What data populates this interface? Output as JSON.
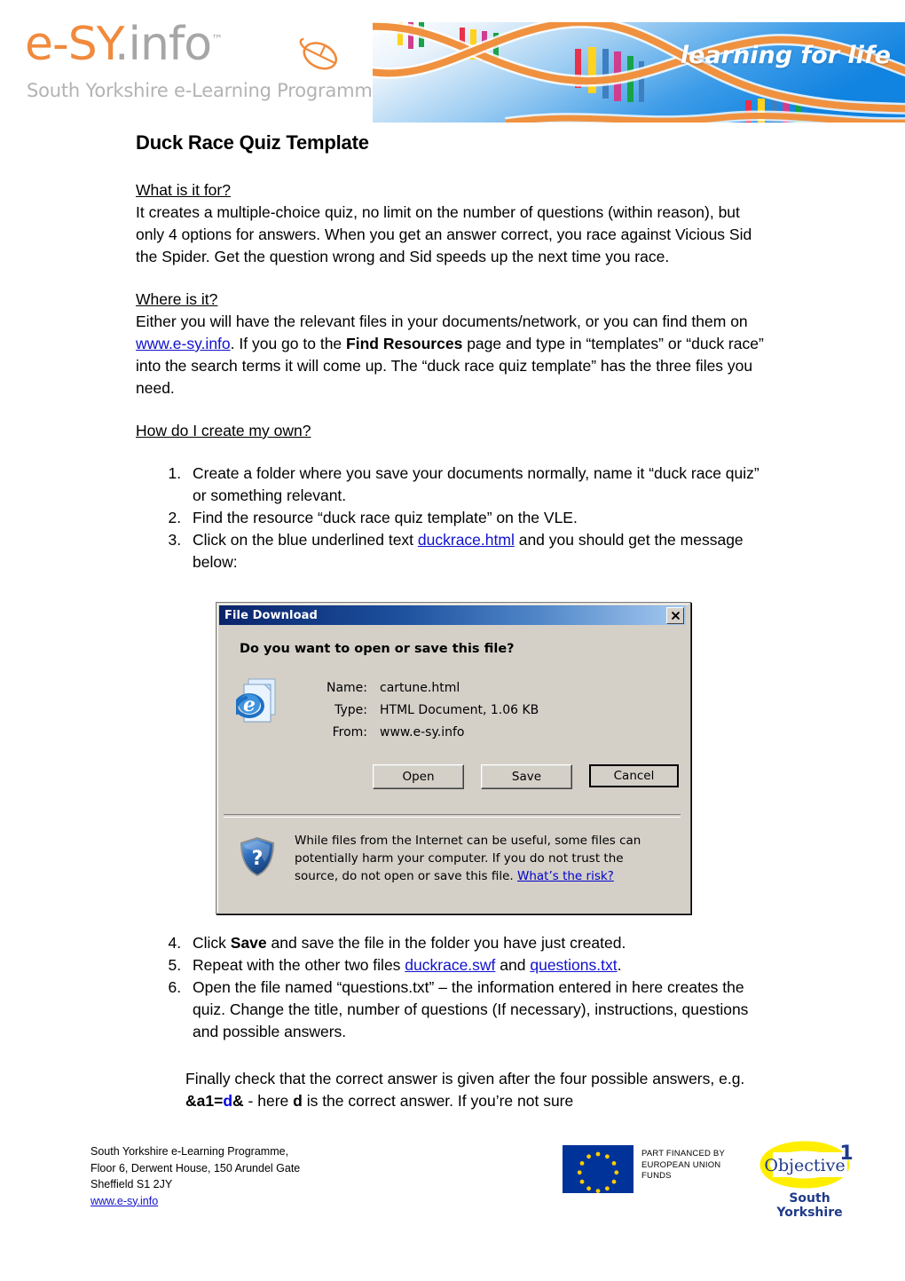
{
  "header": {
    "logo_main_orange": "e-SY",
    "logo_main_grey": ".info",
    "logo_tm": "™",
    "logo_subtitle": "South Yorkshire e-Learning Programme",
    "banner_tagline": "learning for life"
  },
  "document": {
    "title": "Duck Race Quiz Template",
    "section1": {
      "heading": "What is it for?",
      "body": "It creates a multiple-choice quiz, no limit on the number of questions (within reason), but only 4 options for answers. When you get an answer correct, you race against Vicious Sid the Spider. Get the question wrong and Sid speeds up the next time you race."
    },
    "section2": {
      "heading": "Where is it? ",
      "body_part1": "Either you will have the relevant files in your documents/network, or you can find them on ",
      "link_text": "www.e-sy.info",
      "body_part2": ". If you go to the ",
      "bold_text": "Find Resources",
      "body_part3": " page and type in “templates” or “duck race” into the search terms it will come up. The “duck race quiz template” has the three files you need."
    },
    "section3": {
      "heading": "How do I create my own?"
    },
    "steps_upper": [
      {
        "text_before": "Create a folder where you save your documents normally, name it “duck race quiz” or something relevant.",
        "link": "",
        "text_after": ""
      },
      {
        "text_before": "Find the resource “duck race quiz template” on the VLE.",
        "link": "",
        "text_after": ""
      },
      {
        "text_before": "Click on the blue underlined text ",
        "link": "duckrace.html",
        "text_after": " and you should get the message below:"
      }
    ],
    "steps_lower": [
      {
        "prefix": "Click ",
        "bold": "Save",
        "suffix": " and save the file in the folder you have just created."
      },
      {
        "prefix": "Repeat with the other two files ",
        "link1": "duckrace.swf",
        "mid": " and ",
        "link2": "questions.txt",
        "suffix": "."
      },
      {
        "prefix": "Open the file named “questions.txt” – the information entered in here creates the quiz. Change the title, number of questions (If necessary), instructions, questions and possible answers.",
        "bold": "",
        "suffix": ""
      }
    ],
    "final_paragraph": {
      "part1": "Finally check that the correct answer is given after the four possible answers, e.g. ",
      "code_black1": "&a1=",
      "code_blue": "d",
      "code_black2": "&",
      "part2": " - here ",
      "bold_d": "d",
      "part3": " is the correct answer. If you’re not sure"
    }
  },
  "dialog": {
    "title": "File Download",
    "close_label": "✕",
    "question": "Do you want to open or save this file?",
    "fields": [
      {
        "label": "Name:",
        "value": "cartune.html"
      },
      {
        "label": "Type:",
        "value": "HTML Document, 1.06 KB"
      },
      {
        "label": "From:",
        "value": "www.e-sy.info"
      }
    ],
    "buttons": [
      {
        "label": "Open",
        "default": false
      },
      {
        "label": "Save",
        "default": false
      },
      {
        "label": "Cancel",
        "default": true
      }
    ],
    "warning_text": "While files from the Internet can be useful, some files can potentially harm your computer. If you do not trust the source, do not open or save this file. ",
    "warning_link": "What’s the risk?",
    "colors": {
      "titlebar_start": "#0a246a",
      "titlebar_end": "#a6caf0",
      "face": "#d4d0c8"
    }
  },
  "footer": {
    "address_line1": "South Yorkshire e-Learning Programme,",
    "address_line2": "Floor 6, Derwent House, 150 Arundel Gate",
    "address_line3": "Sheffield S1 2JY",
    "website": "www.e-sy.info",
    "eu_funding_line1": "PART FINANCED BY",
    "eu_funding_line2": "EUROPEAN UNION",
    "eu_funding_line3": "FUNDS",
    "objective_word": "Objective",
    "objective_number": "1",
    "objective_region_line1": "South",
    "objective_region_line2": "Yorkshire",
    "colors": {
      "eu_blue": "#003399",
      "eu_star_yellow": "#ffcc00",
      "objective_blue": "#1f3a8a",
      "objective_yellow": "#ffee00"
    }
  }
}
